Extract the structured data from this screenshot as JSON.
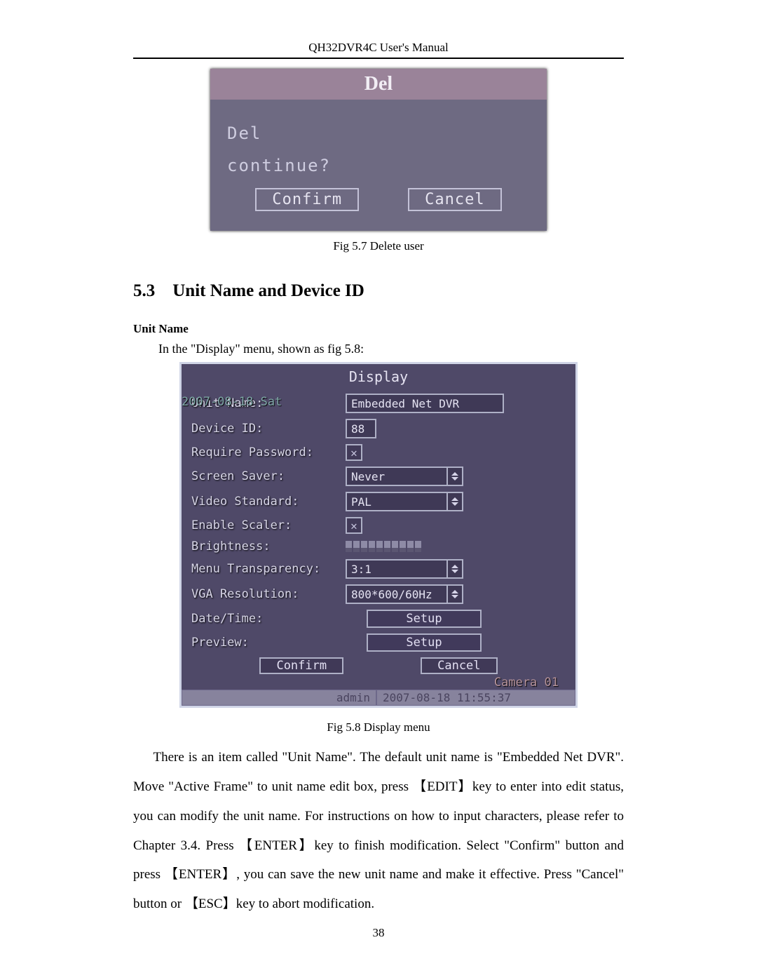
{
  "header": "QH32DVR4C User's Manual",
  "del_dialog": {
    "title": "Del",
    "line1": "Del",
    "line2": "continue?",
    "confirm": "Confirm",
    "cancel": "Cancel"
  },
  "fig57": "Fig 5.7 Delete user",
  "section": {
    "num": "5.3",
    "title": "Unit Name and Device ID"
  },
  "subhead": "Unit Name",
  "intro_line": "In the \"Display\" menu, shown as fig 5.8:",
  "display_menu": {
    "title": "Display",
    "date_overlay": "2007-08-18 Sat",
    "fields": {
      "unit_name": {
        "label": "Unit Name:",
        "value": "Embedded Net DVR"
      },
      "device_id": {
        "label": "Device ID:",
        "value": "88"
      },
      "require_password": {
        "label": "Require Password:"
      },
      "screen_saver": {
        "label": "Screen Saver:",
        "value": "Never"
      },
      "video_standard": {
        "label": "Video Standard:",
        "value": "PAL"
      },
      "enable_scaler": {
        "label": "Enable Scaler:"
      },
      "brightness": {
        "label": "Brightness:"
      },
      "menu_transparency": {
        "label": "Menu Transparency:",
        "value": "3:1"
      },
      "vga_resolution": {
        "label": "VGA Resolution:",
        "value": "800*600/60Hz"
      },
      "date_time": {
        "label": "Date/Time:",
        "button": "Setup"
      },
      "preview": {
        "label": "Preview:",
        "button": "Setup"
      }
    },
    "confirm": "Confirm",
    "cancel": "Cancel",
    "camera_label": "Camera 01",
    "status_user": "admin",
    "status_time": "2007-08-18 11:55:37"
  },
  "fig58": "Fig 5.8 Display menu",
  "paragraph": "There is an item called \"Unit Name\". The default unit name is \"Embedded Net DVR\". Move \"Active Frame\" to unit name edit box, press 【EDIT】key to enter into edit status, you can modify the unit name. For instructions on how to input characters, please refer to Chapter 3.4. Press 【ENTER】key to finish modification. Select \"Confirm\" button and press 【ENTER】, you can save the new unit name and make it effective. Press \"Cancel\" button or 【ESC】key to abort modification.",
  "page_number": "38"
}
